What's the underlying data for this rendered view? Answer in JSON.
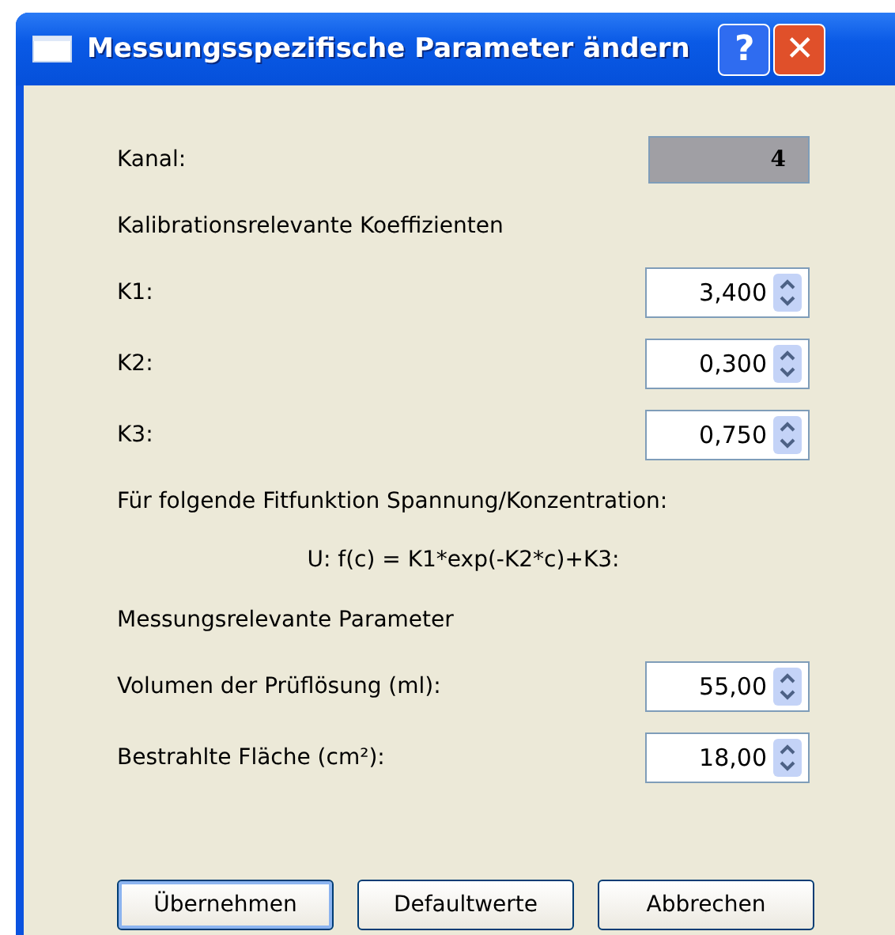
{
  "window": {
    "title": "Messungsspezifische Parameter ändern",
    "help_button": "?",
    "close_button": "✕"
  },
  "rows": [
    {
      "kind": "readonly",
      "label": "Kanal:",
      "value": "4"
    },
    {
      "kind": "heading",
      "label": "Kalibrationsrelevante Koeffizienten"
    },
    {
      "kind": "spin",
      "label": "K1:",
      "value": "3,400"
    },
    {
      "kind": "spin",
      "label": "K2:",
      "value": "0,300"
    },
    {
      "kind": "spin",
      "label": "K3:",
      "value": "0,750"
    },
    {
      "kind": "heading",
      "label": "Für folgende Fitfunktion Spannung/Konzentration:"
    },
    {
      "kind": "formula",
      "label": "U: f(c) = K1*exp(-K2*c)+K3:"
    },
    {
      "kind": "heading",
      "label": "Messungsrelevante Parameter"
    },
    {
      "kind": "spin",
      "label": "Volumen der Prüflösung (ml):",
      "value": "55,00"
    },
    {
      "kind": "spin",
      "label": "Bestrahlte Fläche (cm²):",
      "value": "18,00"
    }
  ],
  "buttons": [
    {
      "label": "Übernehmen",
      "default": true
    },
    {
      "label": "Defaultwerte",
      "default": false
    },
    {
      "label": "Abbrechen",
      "default": false
    }
  ]
}
